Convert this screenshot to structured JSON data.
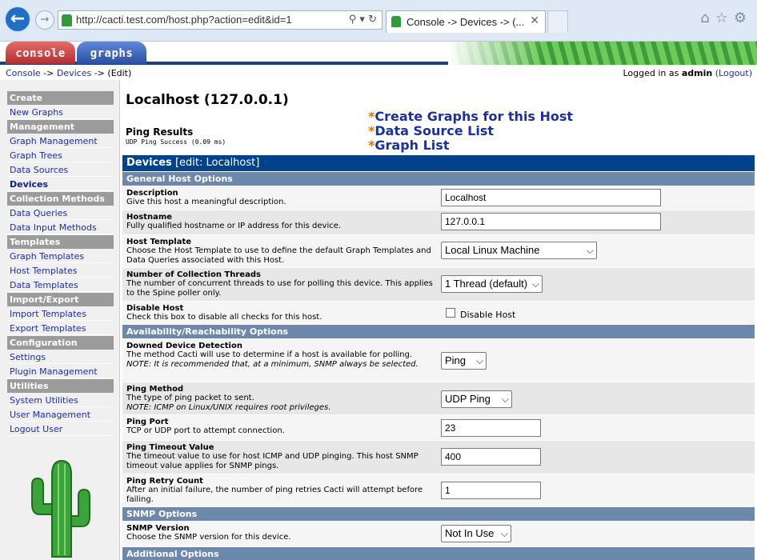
{
  "browser": {
    "back_icon": "back-arrow-icon",
    "address": "http://cacti.test.com/host.php?action=edit&id=1",
    "address_icons": "⚲ ▾ ↻",
    "tab_title": "Console -> Devices -> (...",
    "tab_close": "✕",
    "right_icons": "⌂☆⚙"
  },
  "header": {
    "tabs": [
      {
        "label": "console"
      },
      {
        "label": "graphs"
      }
    ]
  },
  "breadcrumb": {
    "console": "Console",
    "sep1": " -> ",
    "devices": "Devices",
    "sep2": " -> (Edit)"
  },
  "login": {
    "prefix": "Logged in as ",
    "user": "admin",
    "logout": "(Logout)"
  },
  "sidebar": {
    "items": [
      {
        "type": "head",
        "label": "Create"
      },
      {
        "type": "item",
        "label": "New Graphs"
      },
      {
        "type": "head",
        "label": "Management"
      },
      {
        "type": "item",
        "label": "Graph Management"
      },
      {
        "type": "item",
        "label": "Graph Trees"
      },
      {
        "type": "item",
        "label": "Data Sources"
      },
      {
        "type": "item",
        "label": "Devices"
      },
      {
        "type": "head",
        "label": "Collection Methods"
      },
      {
        "type": "item",
        "label": "Data Queries"
      },
      {
        "type": "item",
        "label": "Data Input Methods"
      },
      {
        "type": "head",
        "label": "Templates"
      },
      {
        "type": "item",
        "label": "Graph Templates"
      },
      {
        "type": "item",
        "label": "Host Templates"
      },
      {
        "type": "item",
        "label": "Data Templates"
      },
      {
        "type": "head",
        "label": "Import/Export"
      },
      {
        "type": "item",
        "label": "Import Templates"
      },
      {
        "type": "item",
        "label": "Export Templates"
      },
      {
        "type": "head",
        "label": "Configuration"
      },
      {
        "type": "item",
        "label": "Settings"
      },
      {
        "type": "item",
        "label": "Plugin Management"
      },
      {
        "type": "head",
        "label": "Utilities"
      },
      {
        "type": "item",
        "label": "System Utilities"
      },
      {
        "type": "item",
        "label": "User Management"
      },
      {
        "type": "item",
        "label": "Logout User"
      }
    ]
  },
  "main": {
    "title": "Localhost (127.0.0.1)",
    "ping_results_label": "Ping Results",
    "ping_results_text": "UDP Ping Success (0.09 ms)",
    "quick_links": [
      {
        "star": "*",
        "label": "Create Graphs for this Host"
      },
      {
        "star": "*",
        "label": "Data Source List"
      },
      {
        "star": "*",
        "label": "Graph List"
      }
    ],
    "section": {
      "title": "Devices",
      "subtitle": " [edit: Localhost]"
    },
    "groups": {
      "general": "General Host Options",
      "availability": "Availability/Reachability Options",
      "snmp": "SNMP Options",
      "additional": "Additional Options"
    },
    "fields": {
      "description": {
        "label": "Description",
        "desc": "Give this host a meaningful description.",
        "value": "Localhost"
      },
      "hostname": {
        "label": "Hostname",
        "desc": "Fully qualified hostname or IP address for this device.",
        "value": "127.0.0.1"
      },
      "host_template": {
        "label": "Host Template",
        "desc": "Choose the Host Template to use to define the default Graph Templates and Data Queries associated with this Host.",
        "value": "Local Linux Machine"
      },
      "threads": {
        "label": "Number of Collection Threads",
        "desc": "The number of concurrent threads to use for polling this device. This applies to the Spine poller only.",
        "value": "1 Thread (default)"
      },
      "disable_host": {
        "label": "Disable Host",
        "desc": "Check this box to disable all checks for this host.",
        "checkbox_label": "Disable Host"
      },
      "downed_detection": {
        "label": "Downed Device Detection",
        "desc": "The method Cacti will use to determine if a host is available for polling.",
        "note": "NOTE: It is recommended that, at a minimum, SNMP always be selected.",
        "value": "Ping"
      },
      "ping_method": {
        "label": "Ping Method",
        "desc": "The type of ping packet to sent.",
        "note": "NOTE: ICMP on Linux/UNIX requires root privileges.",
        "value": "UDP Ping"
      },
      "ping_port": {
        "label": "Ping Port",
        "desc": "TCP or UDP port to attempt connection.",
        "value": "23"
      },
      "ping_timeout": {
        "label": "Ping Timeout Value",
        "desc": "The timeout value to use for host ICMP and UDP pinging. This host SNMP timeout value applies for SNMP pings.",
        "value": "400"
      },
      "ping_retry": {
        "label": "Ping Retry Count",
        "desc": "After an initial failure, the number of ping retries Cacti will attempt before failing.",
        "value": "1"
      },
      "snmp_version": {
        "label": "SNMP Version",
        "desc": "Choose the SNMP version for this device.",
        "value": "Not In Use"
      }
    },
    "select_arrow": "⌵"
  }
}
